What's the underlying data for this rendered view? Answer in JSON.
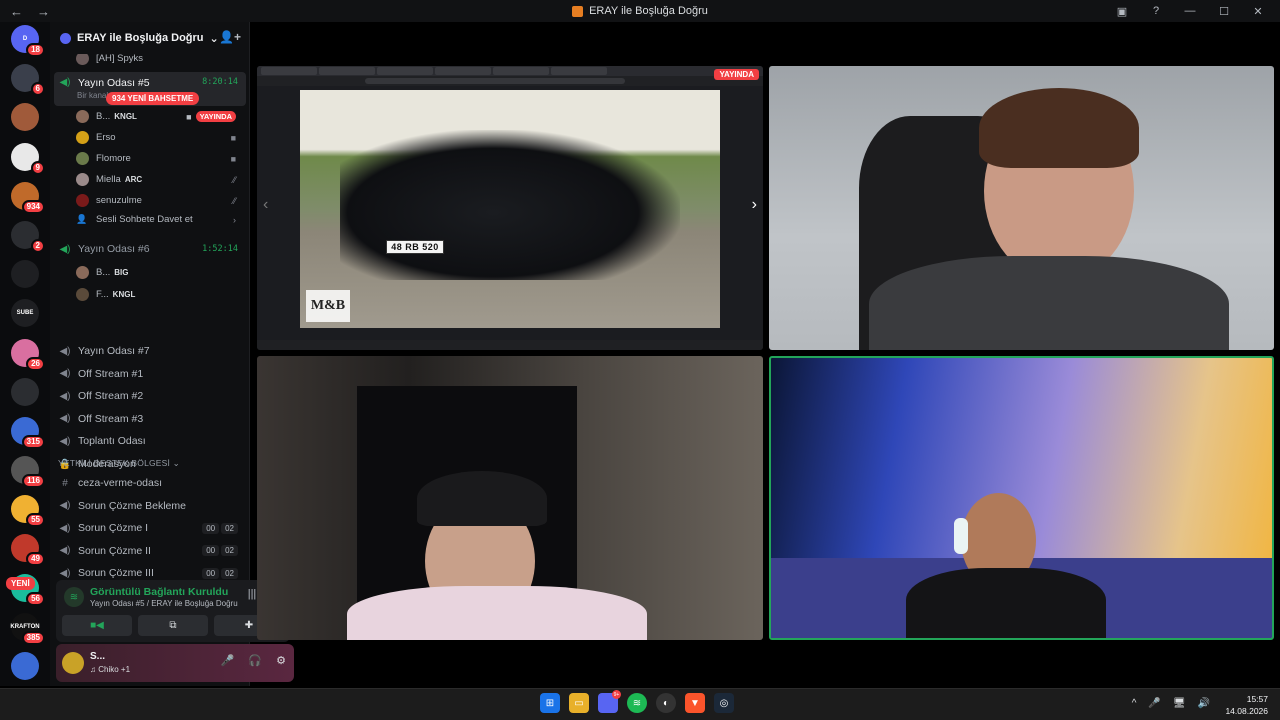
{
  "window": {
    "title": "ERAY ile Boşluğa Doğru"
  },
  "servers": [
    {
      "badge": "18",
      "color": "#5865f2",
      "label": "D"
    },
    {
      "badge": "6",
      "color": "#3a3f4b",
      "label": ""
    },
    {
      "badge": "",
      "color": "#a05a3a",
      "label": ""
    },
    {
      "badge": "9",
      "color": "#e8e8e8",
      "label": ""
    },
    {
      "badge": "934",
      "color": "#c06a2a",
      "label": ""
    },
    {
      "badge": "2",
      "color": "#2b2d31",
      "label": ""
    },
    {
      "badge": "",
      "color": "#1e1f22",
      "label": ""
    },
    {
      "badge": "",
      "color": "#1e1f22",
      "label": "SUBE"
    },
    {
      "badge": "26",
      "color": "#d96fa0",
      "label": ""
    },
    {
      "badge": "",
      "color": "#2b2d31",
      "label": ""
    },
    {
      "badge": "315",
      "color": "#3a6ad4",
      "label": ""
    },
    {
      "badge": "116",
      "color": "#555",
      "label": ""
    },
    {
      "badge": "55",
      "color": "#f0b132",
      "label": ""
    },
    {
      "badge": "49",
      "color": "#c0392b",
      "label": ""
    },
    {
      "badge": "56",
      "color": "#1abc9c",
      "label": ""
    },
    {
      "badge": "385",
      "color": "#111",
      "label": "KRAFTON"
    },
    {
      "badge": "",
      "color": "#3a6ad4",
      "label": ""
    }
  ],
  "servers_new_label": "YENİ",
  "guild": {
    "name": "ERAY ile Boşluğa Doğru"
  },
  "channels": {
    "top_partial_user": "[AH] Spyks",
    "new_mentions_pill": "934 YENİ BAHSETME",
    "active_channel": {
      "name": "Yayın Odası #5",
      "timer": "8:20:14",
      "status": "Bir kanal durumu belirle"
    },
    "active_users": [
      {
        "name": "B...",
        "tag": "KNGL",
        "live": "YAYINDA",
        "color": "#8a6a5a"
      },
      {
        "name": "Erso",
        "tag": "",
        "live": "",
        "color": "#d4a017"
      },
      {
        "name": "Flomore",
        "tag": "",
        "live": "",
        "color": "#6a7a4a"
      },
      {
        "name": "Miella",
        "tag": "ARC",
        "live": "",
        "color": "#9a8a8a"
      },
      {
        "name": "senuzulme",
        "tag": "",
        "live": "",
        "color": "#7a1a1a"
      }
    ],
    "invite_label": "Sesli Sohbete Davet et",
    "room6": {
      "name": "Yayın Odası #6",
      "timer": "1:52:14"
    },
    "room6_users": [
      {
        "name": "B...",
        "tag": "BIG",
        "color": "#8a6a5a"
      },
      {
        "name": "F...",
        "tag": "KNGL",
        "color": "#5a4a3a"
      }
    ],
    "voice_list": [
      "Yayın Odası #7",
      "Off Stream #1",
      "Off Stream #2",
      "Off Stream #3",
      "Toplantı Odası",
      "Moderasyon"
    ],
    "category": "YETKİLİ DESTEK BÖLGESİ",
    "support": [
      {
        "name": "ceza-verme-odası",
        "type": "text",
        "c1": "",
        "c2": ""
      },
      {
        "name": "Sorun Çözme Bekleme",
        "type": "voice",
        "c1": "",
        "c2": ""
      },
      {
        "name": "Sorun Çözme I",
        "type": "voice",
        "c1": "00",
        "c2": "02"
      },
      {
        "name": "Sorun Çözme II",
        "type": "voice",
        "c1": "00",
        "c2": "02"
      },
      {
        "name": "Sorun Çözme III",
        "type": "voice",
        "c1": "00",
        "c2": "02"
      }
    ]
  },
  "voice_panel": {
    "status": "Görüntülü Bağlantı Kuruldu",
    "location": "Yayın Odası #5 / ERAY ile Boşluğa Doğru"
  },
  "user_panel": {
    "name": "S...",
    "activity": "♫ Chiko +1"
  },
  "stream": {
    "live_label": "YAYINDA",
    "plate": "48 RB 520",
    "watermark": "M&B"
  },
  "taskbar": {
    "time": "15:57",
    "date": "14.08.2026",
    "discord_badge": "9+"
  }
}
